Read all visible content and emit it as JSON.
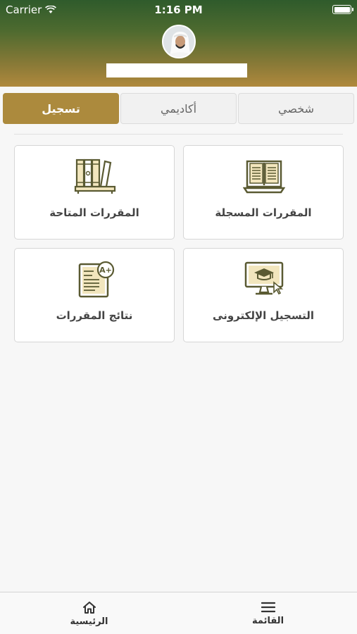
{
  "status_bar": {
    "carrier": "Carrier",
    "time": "1:16 PM"
  },
  "tabs": [
    {
      "label": "شخصي",
      "active": false
    },
    {
      "label": "أكاديمي",
      "active": false
    },
    {
      "label": "تسجيل",
      "active": true
    }
  ],
  "cards": [
    {
      "label": "المقررات المسجلة",
      "icon": "open-book-icon"
    },
    {
      "label": "المقررات المتاحة",
      "icon": "books-shelf-icon"
    },
    {
      "label": "التسجيل الإلكترونى",
      "icon": "graduation-monitor-icon"
    },
    {
      "label": "نتائج المقررات",
      "icon": "grade-report-icon"
    }
  ],
  "bottom_nav": {
    "menu_label": "القائمة",
    "home_label": "الرئيسية"
  },
  "colors": {
    "accent": "#ac8a3d",
    "header_top": "#2f5b2c",
    "header_bottom": "#b0893d",
    "icon": "#5a5a32"
  }
}
